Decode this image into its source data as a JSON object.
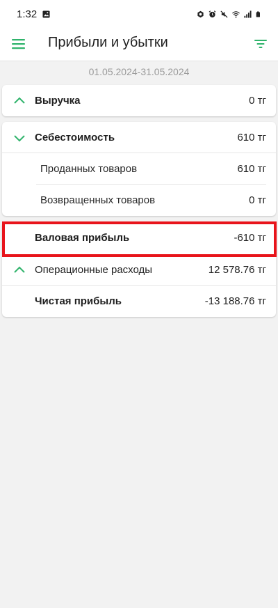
{
  "status_bar": {
    "time": "1:32",
    "icons": [
      "image-icon",
      "assistant-icon",
      "alarm-icon",
      "mute-icon",
      "wifi-icon",
      "signal-icon",
      "battery-icon"
    ]
  },
  "app_bar": {
    "title": "Прибыли и убытки",
    "menu_icon": "hamburger-menu-icon",
    "filter_icon": "filter-icon"
  },
  "date_range": "01.05.2024-31.05.2024",
  "report": {
    "revenue": {
      "label": "Выручка",
      "value": "0 тг",
      "expanded": false
    },
    "cost": {
      "label": "Себестоимость",
      "value": "610 тг",
      "expanded": true,
      "items": [
        {
          "label": "Проданных товаров",
          "value": "610 тг"
        },
        {
          "label": "Возвращенных товаров",
          "value": "0 тг"
        }
      ]
    },
    "gross_profit": {
      "label": "Валовая прибыль",
      "value": "-610 тг"
    },
    "operating_expenses": {
      "label": "Операционные расходы",
      "value": "12 578.76 тг",
      "expanded": false
    },
    "net_profit": {
      "label": "Чистая прибыль",
      "value": "-13 188.76 тг"
    }
  },
  "colors": {
    "accent": "#2fb36b",
    "highlight": "#e8141b",
    "background": "#f2f2f2"
  }
}
